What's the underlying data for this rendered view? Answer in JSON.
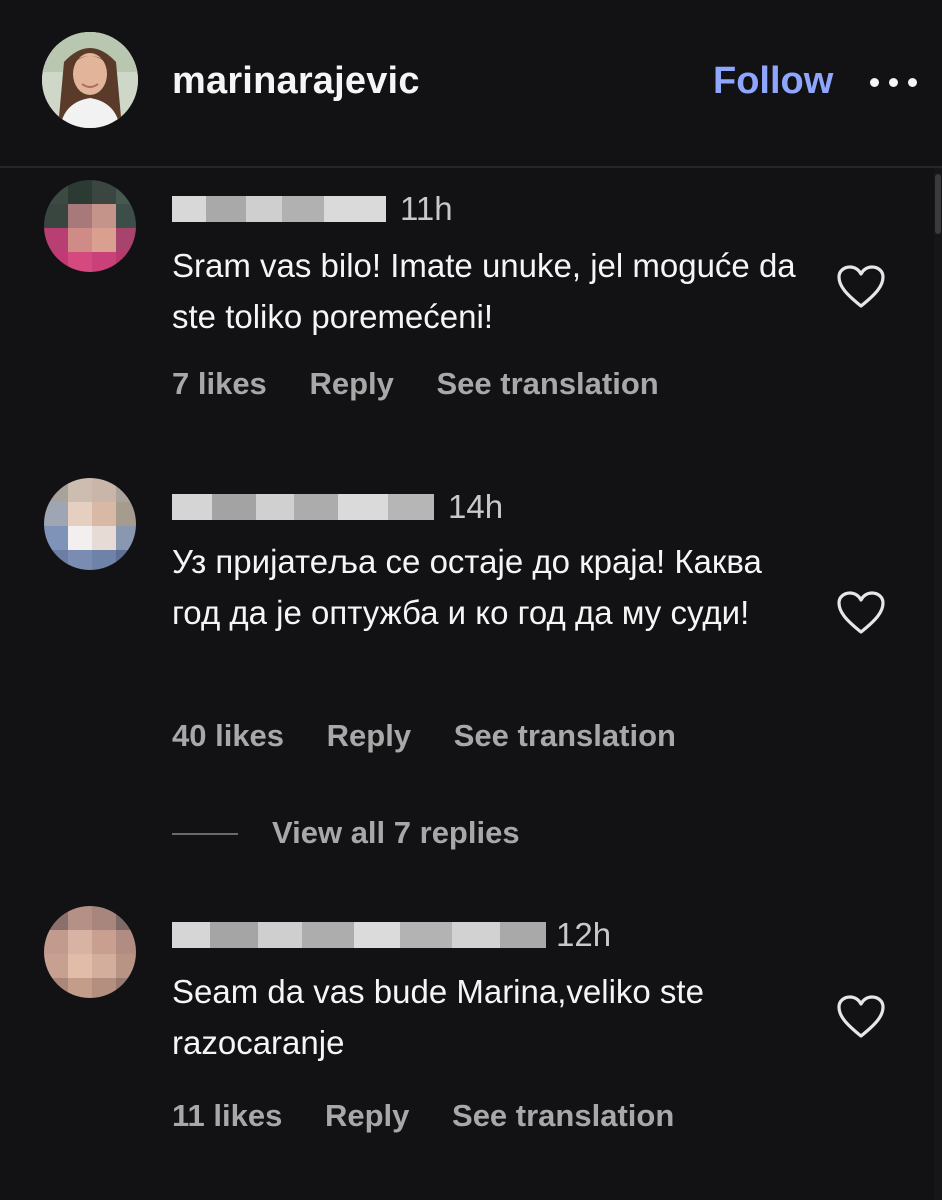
{
  "header": {
    "username": "marinarajevic",
    "follow_label": "Follow",
    "more_icon": "more-horizontal-icon"
  },
  "comments": [
    {
      "time": "11h",
      "text": "Sram vas bilo! Imate unuke, jel moguće da ste toliko poremećeni!",
      "likes": "7 likes",
      "reply": "Reply",
      "translate": "See translation",
      "heart_icon": "heart-outline-icon"
    },
    {
      "time": "14h",
      "text": "Уз пријатеља се остаје до краја! Каква год да је оптужба и ко год да му суди!",
      "likes": "40 likes",
      "reply": "Reply",
      "translate": "See translation",
      "heart_icon": "heart-outline-icon"
    },
    {
      "time": "12h",
      "text": "Seam da vas bude Marina,veliko ste razocaranje",
      "likes": "11 likes",
      "reply": "Reply",
      "translate": "See translation",
      "heart_icon": "heart-outline-icon"
    }
  ],
  "replies": {
    "view_all_label": "View all 7 replies"
  },
  "colors": {
    "background": "#121215",
    "primary_text": "#f5f5f5",
    "secondary_text": "#a8a8a8",
    "follow_link": "#8fa6ff"
  }
}
